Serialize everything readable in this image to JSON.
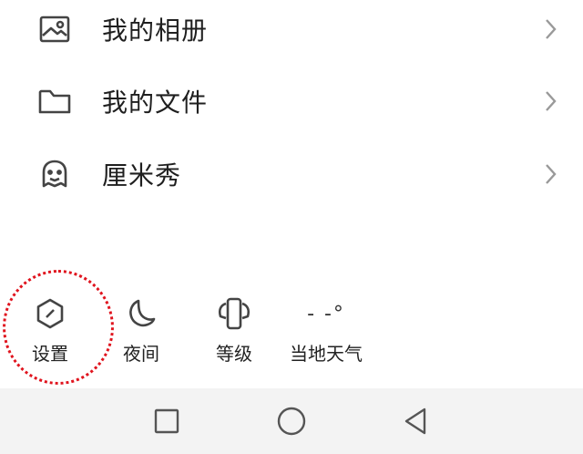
{
  "menu": [
    {
      "label": "我的相册",
      "icon": "photo-album-icon"
    },
    {
      "label": "我的文件",
      "icon": "folder-icon"
    },
    {
      "label": "厘米秀",
      "icon": "ghost-mascot-icon"
    }
  ],
  "quick_actions": [
    {
      "label": "设置",
      "icon": "settings-hexagon-icon"
    },
    {
      "label": "夜间",
      "icon": "moon-icon"
    },
    {
      "label": "等级",
      "icon": "level-badge-icon"
    },
    {
      "label": "当地天气",
      "icon": "weather-icon",
      "value": "- -°"
    }
  ],
  "nav": [
    "recent-apps-icon",
    "home-icon",
    "back-icon"
  ],
  "colors": {
    "highlight": "#e0141e",
    "icon": "#555555",
    "navbar_bg": "#f3f3f3"
  }
}
